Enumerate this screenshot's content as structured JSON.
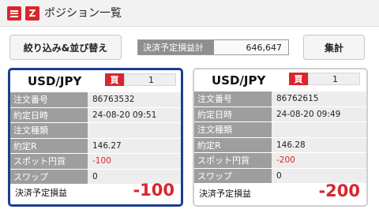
{
  "header": {
    "title": "ポジション一覧",
    "menu_icon": "hamburger-menu-icon",
    "logo_icon": "z-logo-icon",
    "logo_text": "Z",
    "accent_color": "#d9262c"
  },
  "toolbar": {
    "filter_label": "絞り込み&並び替え",
    "summary_label": "決済予定損益計",
    "summary_value": "646,647",
    "total_label": "集計"
  },
  "positions": [
    {
      "pair": "USD/JPY",
      "side": "買",
      "quantity": "1",
      "selected": true,
      "rows": [
        {
          "label": "注文番号",
          "value": "86763532"
        },
        {
          "label": "約定日時",
          "value": "24-08-20 09:51"
        },
        {
          "label": "注文種類",
          "value": ""
        },
        {
          "label": "約定R",
          "value": "146.27"
        },
        {
          "label": "スポット円貨",
          "value": "-100"
        },
        {
          "label": "スワップ",
          "value": "0"
        }
      ],
      "pl_label": "決済予定損益",
      "pl_value": "-100"
    },
    {
      "pair": "USD/JPY",
      "side": "買",
      "quantity": "1",
      "selected": false,
      "rows": [
        {
          "label": "注文番号",
          "value": "86762615"
        },
        {
          "label": "約定日時",
          "value": "24-08-20 09:49"
        },
        {
          "label": "注文種類",
          "value": ""
        },
        {
          "label": "約定R",
          "value": "146.28"
        },
        {
          "label": "スポット円貨",
          "value": "-200"
        },
        {
          "label": "スワップ",
          "value": "0"
        }
      ],
      "pl_label": "決済予定損益",
      "pl_value": "-200"
    }
  ]
}
